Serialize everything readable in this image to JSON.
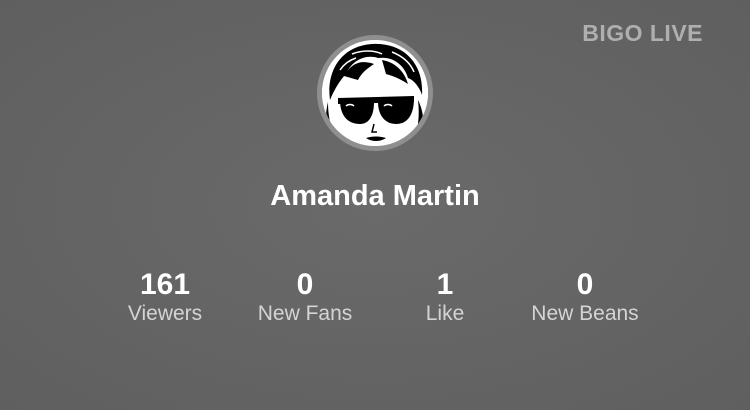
{
  "watermark": "BIGO LIVE",
  "profile": {
    "name": "Amanda Martin",
    "avatar_icon": "user-avatar-sunglasses"
  },
  "stats": {
    "viewers": {
      "value": "161",
      "label": "Viewers"
    },
    "new_fans": {
      "value": "0",
      "label": "New Fans"
    },
    "like": {
      "value": "1",
      "label": "Like"
    },
    "new_beans": {
      "value": "0",
      "label": "New Beans"
    }
  },
  "colors": {
    "background": "#646464",
    "watermark": "#bdbdbd",
    "label": "#d4d4d4"
  }
}
